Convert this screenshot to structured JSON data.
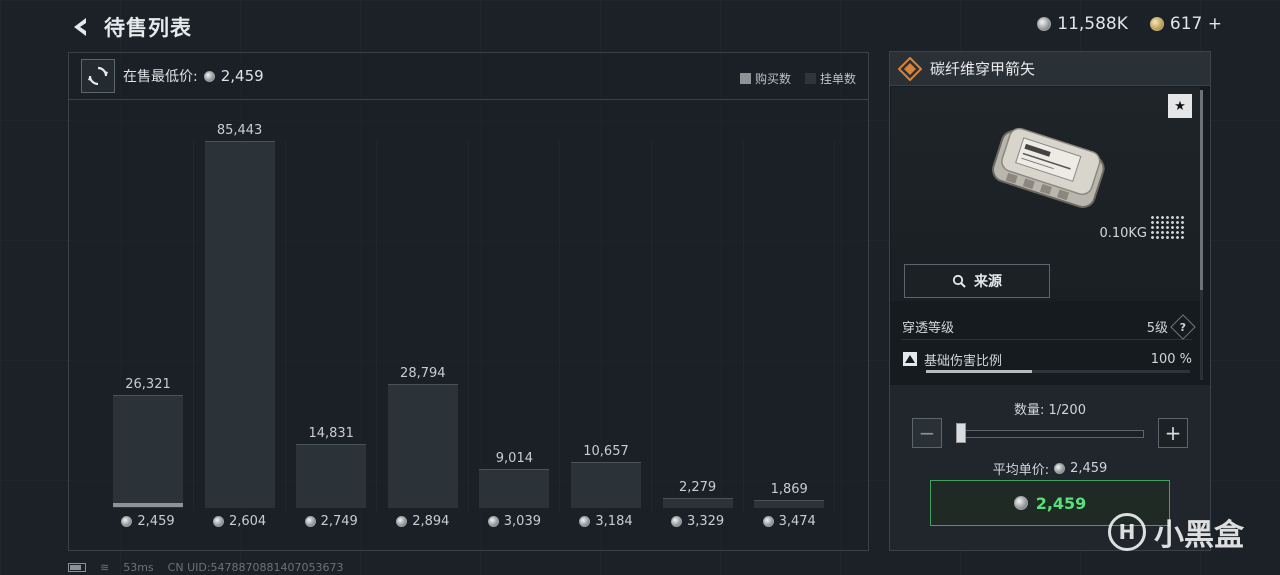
{
  "header": {
    "title": "待售列表"
  },
  "currency": {
    "silver": "11,588K",
    "gold": "617 +"
  },
  "panel": {
    "min_price_label": "在售最低价:",
    "min_price_value": "2,459",
    "legend_buy": "购买数",
    "legend_list": "挂单数"
  },
  "chart_data": {
    "type": "bar",
    "categories": [
      "2,459",
      "2,604",
      "2,749",
      "2,894",
      "3,039",
      "3,184",
      "3,329",
      "3,474"
    ],
    "series": [
      {
        "name": "挂单数",
        "values": [
          26321,
          85443,
          14831,
          28794,
          9014,
          10657,
          2279,
          1869
        ]
      },
      {
        "name": "购买数",
        "values": [
          1,
          0,
          0,
          0,
          0,
          0,
          0,
          0
        ]
      }
    ],
    "labels": [
      "26,321",
      "85,443",
      "14,831",
      "28,794",
      "9,014",
      "10,657",
      "2,279",
      "1,869"
    ],
    "ylim": [
      0,
      85443
    ]
  },
  "item": {
    "name": "碳纤维穿甲箭矢",
    "weight": "0.10KG",
    "source_label": "来源",
    "stat1_label": "穿透等级",
    "stat1_value": "5级",
    "stat2_label": "基础伤害比例",
    "stat2_value": "100 %",
    "stat2_fill": 0.4,
    "qty_label": "数量: 1/200",
    "avg_label": "平均单价:",
    "avg_value": "2,459",
    "buy_value": "2,459"
  },
  "footer": {
    "ping": "53ms",
    "uid": "CN UID:5478870881407053673"
  },
  "watermark": {
    "text": "小黑盒"
  },
  "colors": {
    "buy_green": "#59e07c",
    "accent_orange": "#d9833a"
  }
}
